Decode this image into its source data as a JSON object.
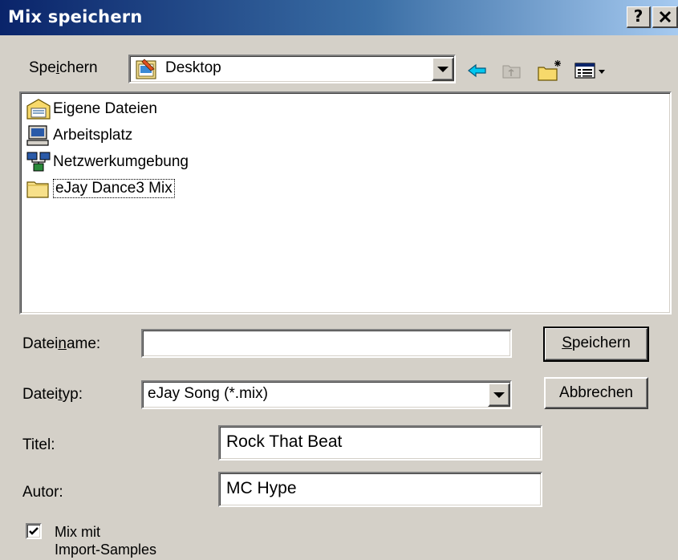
{
  "window": {
    "title": "Mix speichern",
    "help_label": "?",
    "close_label": "×"
  },
  "location": {
    "label_pre": "Spe",
    "label_mnemonic": "i",
    "label_post": "chern",
    "selected": "Desktop"
  },
  "toolbar": {
    "icons": [
      "back-icon",
      "up-folder-icon",
      "new-folder-icon",
      "view-menu-icon"
    ]
  },
  "files": [
    {
      "name": "Eigene Dateien",
      "icon": "my-documents-icon"
    },
    {
      "name": "Arbeitsplatz",
      "icon": "my-computer-icon"
    },
    {
      "name": "Netzwerkumgebung",
      "icon": "network-icon"
    },
    {
      "name": "eJay Dance3  Mix",
      "icon": "folder-icon",
      "focused": true
    }
  ],
  "filename": {
    "label_pre": "Datei",
    "label_mnemonic": "n",
    "label_post": "ame:",
    "value": ""
  },
  "filetype": {
    "label_pre": "Datei",
    "label_mnemonic": "t",
    "label_post": "yp:",
    "value": "eJay Song (*.mix)"
  },
  "title_field": {
    "label": "Titel:",
    "value": "Rock That Beat"
  },
  "author_field": {
    "label": "Autor:",
    "value": "MC Hype"
  },
  "checkbox": {
    "label_line1": "Mix mit",
    "label_line2": "Import-Samples",
    "checked": true
  },
  "buttons": {
    "save_mnemonic": "S",
    "save_rest": "peichern",
    "cancel": "Abbrechen"
  }
}
